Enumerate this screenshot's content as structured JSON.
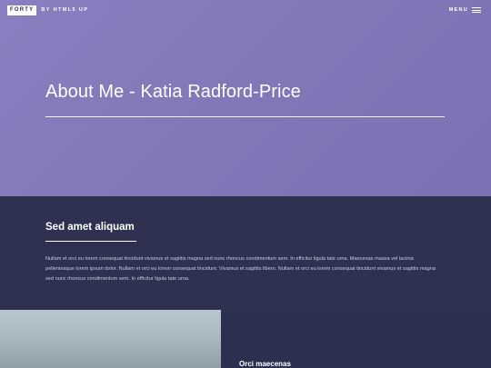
{
  "header": {
    "logo_text": "FORTY",
    "logo_byline": "BY HTML5 UP",
    "menu_label": "MENU"
  },
  "banner": {
    "title": "About Me - Katia Radford-Price"
  },
  "section1": {
    "heading": "Sed amet aliquam",
    "paragraph": "Nullam et orci eu lorem consequat tincidunt vivamus et sagittis magna sed nunc rhoncus condimentum sem. In efficitur ligula tate urna. Maecenas massa vel lacinia pellentesque lorem ipsum dolor. Nullam et orci eu lorem consequat tincidunt. Vivamus et sagittis libero. Nullam et orci eu lorem consequat tincidunt vivamus et sagittis magna sed nunc rhoncus condimentum sem. In efficitur ligula tate urna."
  },
  "tiles": [
    {
      "type": "image"
    },
    {
      "type": "text",
      "heading": "Orci maecenas"
    }
  ],
  "colors": {
    "banner": "#8a7fc0",
    "section": "#2e3250",
    "tile_dark": "#2c3050"
  },
  "icons": {
    "menu": "hamburger-icon"
  }
}
